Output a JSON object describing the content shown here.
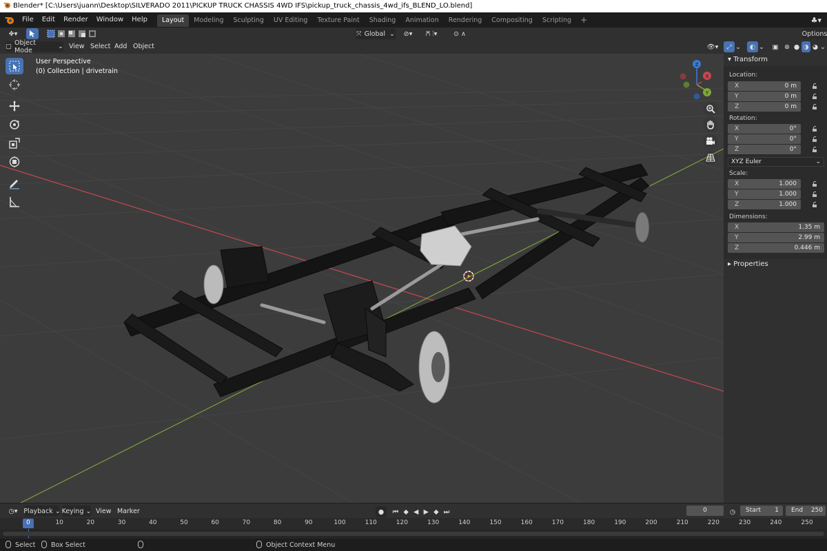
{
  "window_title": "Blender* [C:\\Users\\juann\\Desktop\\SILVERADO 2011\\PICKUP TRUCK CHASSIS 4WD IFS\\pickup_truck_chassis_4wd_ifs_BLEND_LO.blend]",
  "menu": [
    "File",
    "Edit",
    "Render",
    "Window",
    "Help"
  ],
  "workspaces": [
    "Layout",
    "Modeling",
    "Sculpting",
    "UV Editing",
    "Texture Paint",
    "Shading",
    "Animation",
    "Rendering",
    "Compositing",
    "Scripting"
  ],
  "active_workspace": "Layout",
  "header": {
    "options_label": "Options",
    "transform_orientation": "Global",
    "mode": "Object Mode",
    "view_menu": [
      "View",
      "Select",
      "Add",
      "Object"
    ]
  },
  "viewport": {
    "perspective_label": "User Perspective",
    "collection_label": "(0) Collection | drivetrain",
    "gizmo_axes": [
      "X",
      "Y",
      "Z"
    ],
    "colors": {
      "x_axis": "#c8484f",
      "y_axis": "#7fa53a",
      "z_axis": "#3a7bd5",
      "active_tool": "#4772b3"
    }
  },
  "sidebar": {
    "panel_title": "Transform",
    "location_label": "Location:",
    "location": [
      {
        "axis": "X",
        "value": "0 m"
      },
      {
        "axis": "Y",
        "value": "0 m"
      },
      {
        "axis": "Z",
        "value": "0 m"
      }
    ],
    "rotation_label": "Rotation:",
    "rotation": [
      {
        "axis": "X",
        "value": "0°"
      },
      {
        "axis": "Y",
        "value": "0°"
      },
      {
        "axis": "Z",
        "value": "0°"
      }
    ],
    "rotation_mode": "XYZ Euler",
    "scale_label": "Scale:",
    "scale": [
      {
        "axis": "X",
        "value": "1.000"
      },
      {
        "axis": "Y",
        "value": "1.000"
      },
      {
        "axis": "Z",
        "value": "1.000"
      }
    ],
    "dimensions_label": "Dimensions:",
    "dimensions": [
      {
        "axis": "X",
        "value": "1.35 m"
      },
      {
        "axis": "Y",
        "value": "2.99 m"
      },
      {
        "axis": "Z",
        "value": "0.446 m"
      }
    ],
    "properties_label": "Properties"
  },
  "timeline": {
    "menu": [
      "Playback",
      "Keying",
      "View",
      "Marker"
    ],
    "current_frame": "0",
    "start_label": "Start",
    "start": "1",
    "end_label": "End",
    "end": "250",
    "ticks": [
      "0",
      "10",
      "20",
      "30",
      "40",
      "50",
      "60",
      "70",
      "80",
      "90",
      "100",
      "110",
      "120",
      "130",
      "140",
      "150",
      "160",
      "170",
      "180",
      "190",
      "200",
      "210",
      "220",
      "230",
      "240",
      "250"
    ]
  },
  "statusbar": {
    "select": "Select",
    "box_select": "Box Select",
    "context_menu": "Object Context Menu"
  }
}
